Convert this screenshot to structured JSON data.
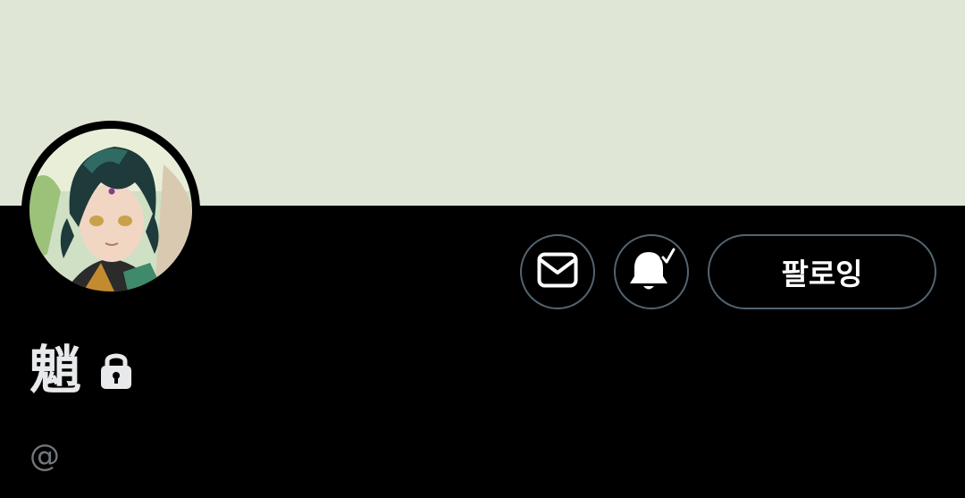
{
  "profile": {
    "display_name": "魈",
    "handle": "@",
    "protected": true
  },
  "actions": {
    "follow_label": "팔로잉"
  },
  "icons": {
    "message": "mail-icon",
    "notifications": "bell-check-icon",
    "protected": "lock-icon"
  },
  "colors": {
    "banner": "#dfe6d6",
    "background": "#000000",
    "button_border": "#536471",
    "text_primary": "#e7e9ea",
    "text_secondary": "#71767b"
  }
}
